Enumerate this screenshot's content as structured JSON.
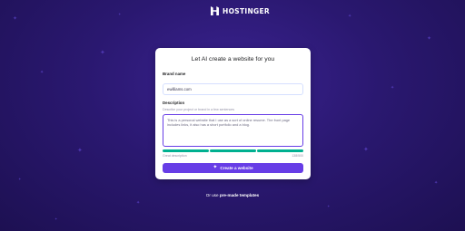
{
  "header": {
    "logo_text": "HOSTINGER",
    "logo_icon": "hostinger-logo-icon"
  },
  "card": {
    "title": "Let AI create a website for you",
    "brand": {
      "label": "Brand name",
      "value": "ewilliams.com"
    },
    "description": {
      "label": "Description",
      "hint": "Describe your project or brand in a few sentences",
      "value": "This is a personal website that I use as a sort of online resume. The front page includes links, it also has a short portfolio and a blog.",
      "quality_label": "Great description",
      "char_count": "138/500",
      "strength_segments_filled": 3,
      "strength_segments_total": 3,
      "strength_color": "#00b090"
    },
    "cta": {
      "label": "Create a website",
      "icon": "sparkle-icon",
      "color": "#673de6"
    }
  },
  "footer": {
    "prefix": "Or use",
    "link_label": "pre-made templates"
  },
  "colors": {
    "background": "#2a1870",
    "sparkle": "#5c43c8"
  }
}
